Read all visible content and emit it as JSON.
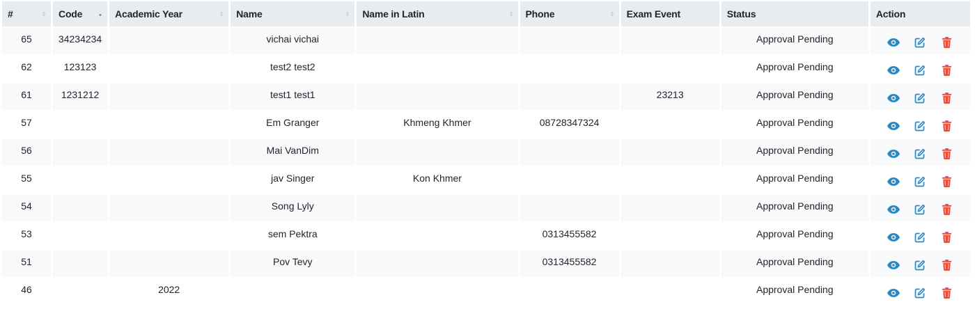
{
  "colors": {
    "header_bg": "#e9ecef",
    "stripe_bg": "#f8f9fa",
    "view_icon": "#2e86c1",
    "edit_icon": "#2e86c1",
    "delete_icon": "#e74c3c"
  },
  "table": {
    "columns": [
      "#",
      "Code",
      "Academic Year",
      "Name",
      "Name in Latin",
      "Phone",
      "Exam Event",
      "Status",
      "Action"
    ],
    "rows": [
      {
        "id": "65",
        "code": "34234234",
        "academic_year": "",
        "name": "vichai vichai",
        "name_latin": "",
        "phone": "",
        "exam_event": "",
        "status": "Approval Pending"
      },
      {
        "id": "62",
        "code": "123123",
        "academic_year": "",
        "name": "test2 test2",
        "name_latin": "",
        "phone": "",
        "exam_event": "",
        "status": "Approval Pending"
      },
      {
        "id": "61",
        "code": "1231212",
        "academic_year": "",
        "name": "test1 test1",
        "name_latin": "",
        "phone": "",
        "exam_event": "23213",
        "status": "Approval Pending"
      },
      {
        "id": "57",
        "code": "",
        "academic_year": "",
        "name": "Em Granger",
        "name_latin": "Khmeng Khmer",
        "phone": "08728347324",
        "exam_event": "",
        "status": "Approval Pending"
      },
      {
        "id": "56",
        "code": "",
        "academic_year": "",
        "name": "Mai VanDim",
        "name_latin": "",
        "phone": "",
        "exam_event": "",
        "status": "Approval Pending"
      },
      {
        "id": "55",
        "code": "",
        "academic_year": "",
        "name": "jav Singer",
        "name_latin": "Kon Khmer",
        "phone": "",
        "exam_event": "",
        "status": "Approval Pending"
      },
      {
        "id": "54",
        "code": "",
        "academic_year": "",
        "name": "Song Lyly",
        "name_latin": "",
        "phone": "",
        "exam_event": "",
        "status": "Approval Pending"
      },
      {
        "id": "53",
        "code": "",
        "academic_year": "",
        "name": "sem Pektra",
        "name_latin": "",
        "phone": "0313455582",
        "exam_event": "",
        "status": "Approval Pending"
      },
      {
        "id": "51",
        "code": "",
        "academic_year": "",
        "name": "Pov Tevy",
        "name_latin": "",
        "phone": "0313455582",
        "exam_event": "",
        "status": "Approval Pending"
      },
      {
        "id": "46",
        "code": "",
        "academic_year": "2022",
        "name": "",
        "name_latin": "",
        "phone": "",
        "exam_event": "",
        "status": "Approval Pending"
      }
    ]
  },
  "icons": {
    "view": "eye-icon",
    "edit": "edit-icon",
    "delete": "trash-icon",
    "sort": "sort-icon"
  }
}
